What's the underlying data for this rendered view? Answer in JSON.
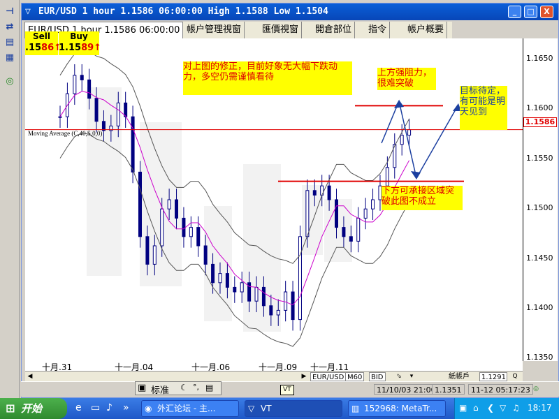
{
  "left_toolbar": {
    "icons": [
      "pin-icon",
      "swap-arrows-icon",
      "tile-icon",
      "tile-vertical-icon",
      "target-icon"
    ]
  },
  "window": {
    "title": "EUR/USD 1 hour 1.1586 06:00:00 High 1.1588 Low 1.1504",
    "min_label": "_",
    "max_label": "□",
    "close_label": "X"
  },
  "tabs": [
    {
      "label": "EUR/USD 1 hour 1.1586 06:00:00"
    },
    {
      "label": "帳户管理視窗"
    },
    {
      "label": "匯價視窗"
    },
    {
      "label": "開倉部位"
    },
    {
      "label": "指令"
    },
    {
      "label": "帳户概要"
    }
  ],
  "sell_buy": {
    "sell_label": "Sell",
    "buy_label": "Buy",
    "sell_value_prefix": ".15",
    "sell_value_big": "86",
    "buy_value_prefix": "1.15",
    "buy_value_big": "89",
    "arrow": "↑"
  },
  "indicator_label": "Moving Average (C,40,S,0,0)",
  "annotations": {
    "correction": "对上图的修正，目前好象无大幅下跌动力，多空仍需谨慎看待",
    "resistance": "上方强阻力，很难突破",
    "target": "目标待定，有可能是明天见到",
    "support": "下方可承接区域突破此图不成立"
  },
  "price_axis": {
    "labels": [
      "1.1650",
      "1.1600",
      "1.1550",
      "1.1500",
      "1.1450",
      "1.1400",
      "1.1350"
    ],
    "current": "1.1586"
  },
  "time_axis": {
    "labels": [
      "十月.31",
      "十一月.04",
      "十一月.06",
      "十一月.09",
      "十一月.11"
    ]
  },
  "scroll_tabs": [
    "EUR/USD",
    "M60",
    "BID"
  ],
  "status": {
    "sheet_label": "紙帳戶",
    "sheet_value": "1.1291",
    "datetime": "11/10/03 21:00",
    "price": "1.1351",
    "server_time": "11-12 05:17:23"
  },
  "ime": {
    "label": "标准"
  },
  "tooltip": "VT",
  "taskbar": {
    "start_label": "开始",
    "items": [
      {
        "label": "外汇论坛 - 主..."
      },
      {
        "label": "VT"
      },
      {
        "label": "152968: MetaTr..."
      }
    ],
    "clock": "18:17"
  },
  "chart_data": {
    "type": "candlestick",
    "symbol": "EUR/USD",
    "timeframe": "1 hour",
    "ylim": [
      1.1335,
      1.1685
    ],
    "current_price": 1.1586,
    "closes": [
      1.16,
      1.1625,
      1.1645,
      1.164,
      1.162,
      1.1595,
      1.1585,
      1.159,
      1.1615,
      1.16,
      1.154,
      1.147,
      1.144,
      1.146,
      1.15,
      1.151,
      1.149,
      1.147,
      1.148,
      1.146,
      1.144,
      1.142,
      1.143,
      1.1415,
      1.141,
      1.142,
      1.14,
      1.1415,
      1.1395,
      1.1385,
      1.139,
      1.141,
      1.138,
      1.147,
      1.152,
      1.1515,
      1.1525,
      1.151,
      1.148,
      1.147,
      1.1465,
      1.149,
      1.15,
      1.151,
      1.1525,
      1.1545,
      1.157,
      1.158,
      1.1586
    ],
    "horizontal_lines": [
      {
        "price": 1.1612,
        "color": "#e00000"
      },
      {
        "price": 1.1586,
        "color": "#e00000"
      },
      {
        "price": 1.153,
        "color": "#e00000"
      }
    ],
    "moving_average": {
      "period": 40,
      "color": "#cc00cc"
    }
  }
}
